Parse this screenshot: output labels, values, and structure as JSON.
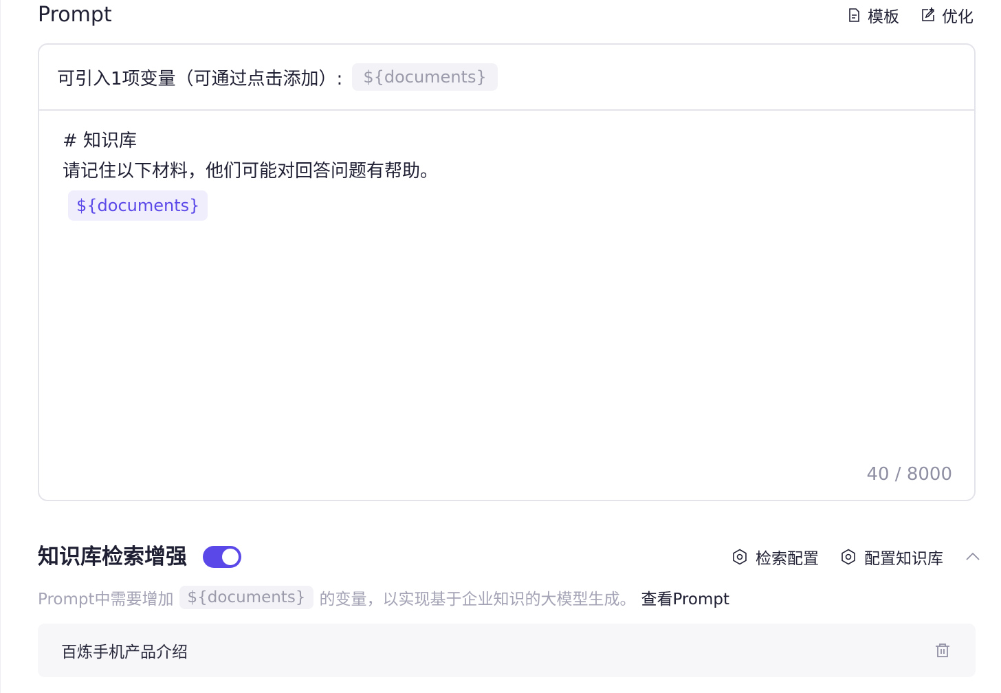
{
  "header": {
    "title": "Prompt",
    "template_label": "模板",
    "optimize_label": "优化"
  },
  "editor": {
    "vars_label": "可引入1项变量（可通过点击添加）:",
    "var_chip": "${documents}",
    "lines": [
      "# 知识库",
      "请记住以下材料，他们可能对回答问题有帮助。"
    ],
    "inserted_var": "${documents}",
    "char_count": "40 / 8000"
  },
  "knowledge": {
    "title": "知识库检索增强",
    "toggle_on": true,
    "retrieval_config_label": "检索配置",
    "kb_config_label": "配置知识库",
    "desc_prefix": "Prompt中需要增加",
    "desc_chip": "${documents}",
    "desc_suffix": "的变量，以实现基于企业知识的大模型生成。",
    "view_prompt_link": "查看Prompt",
    "items": [
      {
        "name": "百炼手机产品介绍"
      }
    ]
  },
  "colors": {
    "accent": "#5b48e8",
    "text": "#1f1f33",
    "muted": "#a3a3b5"
  }
}
